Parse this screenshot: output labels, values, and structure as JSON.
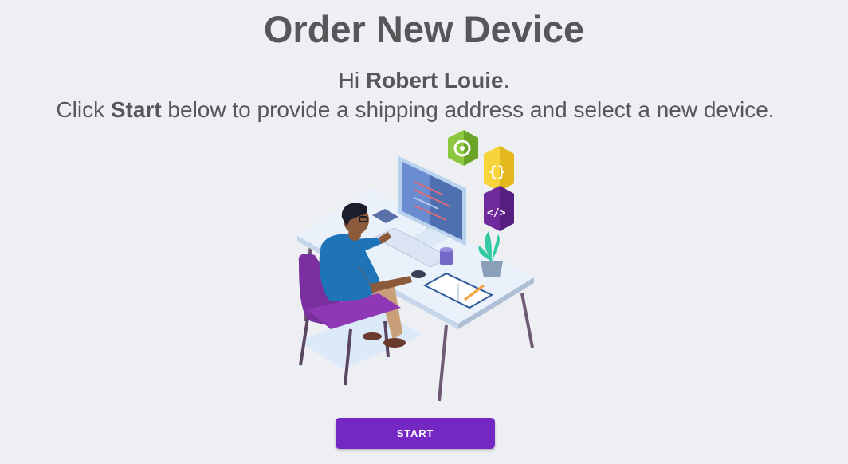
{
  "title": "Order New Device",
  "greeting": {
    "prefix": "Hi ",
    "name": "Robert Louie",
    "suffix": "."
  },
  "instructions": {
    "prefix": "Click ",
    "emphasis": "Start",
    "suffix": " below to provide a shipping address and select a new device."
  },
  "illustration": {
    "subject": "person-working-at-desk-illustration",
    "icons": [
      "gear-icon",
      "curly-braces-icon",
      "code-tag-icon"
    ]
  },
  "start_button": {
    "label": "START"
  },
  "colors": {
    "background": "#eeeff3",
    "text": "#555759",
    "accent": "#7427c2",
    "chair": "#7a2f9e",
    "shirt": "#1f74b8"
  }
}
